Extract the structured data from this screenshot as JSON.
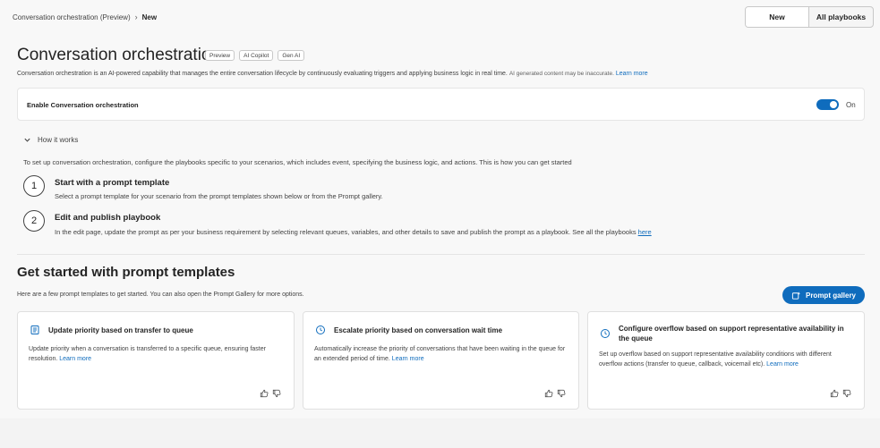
{
  "breadcrumb": {
    "parent": "Conversation orchestration (Preview)",
    "separator": "›",
    "current": "New"
  },
  "top_buttons": {
    "new": "New",
    "all_playbooks": "All playbooks"
  },
  "header": {
    "title": "Conversation orchestration",
    "tags": [
      "Preview",
      "AI Copilot",
      "Gen AI"
    ],
    "description": "Conversation orchestration is an AI-powered capability that manages the entire conversation lifecycle by continuously evaluating triggers and applying business logic in real time.",
    "disclaimer": "AI generated content may be inaccurate.",
    "learn_more": "Learn more"
  },
  "enable": {
    "label": "Enable Conversation orchestration",
    "state_label": "On",
    "enabled": true
  },
  "how_it_works": {
    "label": "How it works",
    "intro": "To set up conversation orchestration, configure the playbooks specific to your scenarios, which includes event, specifying the business logic, and actions. This is how you can get started",
    "steps": [
      {
        "number": "1",
        "title": "Start with a prompt template",
        "desc": "Select a prompt template for your scenario from the prompt templates shown below or from the Prompt gallery."
      },
      {
        "number": "2",
        "title": "Edit and publish playbook",
        "desc": "In the edit page, update the prompt as per your business requirement by selecting relevant queues, variables, and other details to save and publish the prompt as a playbook. See all the playbooks",
        "link": "here"
      }
    ]
  },
  "templates": {
    "title": "Get started with prompt templates",
    "desc": "Here are a few prompt templates to get started. You can also open the Prompt Gallery for more options.",
    "gallery_button": "Prompt gallery",
    "cards": [
      {
        "icon": "document-icon",
        "title": "Update priority based on transfer to queue",
        "desc": "Update priority when a conversation is transferred to a specific queue, ensuring faster resolution.",
        "link": "Learn more"
      },
      {
        "icon": "clock-icon",
        "title": "Escalate priority based on conversation wait time",
        "desc": "Automatically increase the priority of conversations that have been waiting in the queue for an extended period of time.",
        "link": "Learn more"
      },
      {
        "icon": "clock-icon",
        "title": "Configure overflow based on support representative availability in the queue",
        "desc": "Set up overflow based on support representative availability conditions with different overflow actions (transfer to queue, callback, voicemail etc).",
        "link": "Learn more"
      }
    ]
  },
  "colors": {
    "accent": "#0f6cbd",
    "background": "#f8f8f8",
    "card": "#ffffff"
  }
}
